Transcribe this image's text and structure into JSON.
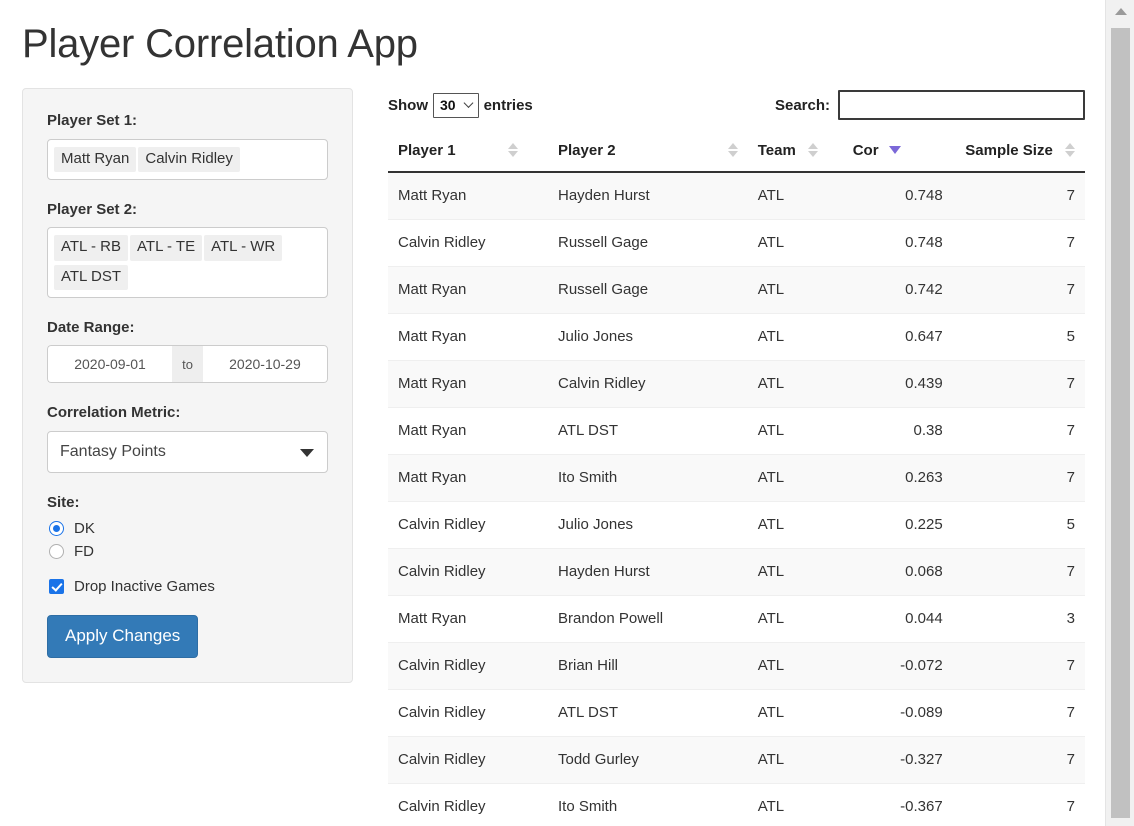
{
  "app": {
    "title": "Player Correlation App"
  },
  "sidebar": {
    "player_set_1": {
      "label": "Player Set 1:",
      "tokens": [
        "Matt Ryan",
        "Calvin Ridley"
      ]
    },
    "player_set_2": {
      "label": "Player Set 2:",
      "tokens": [
        "ATL - RB",
        "ATL - TE",
        "ATL - WR",
        "ATL DST"
      ]
    },
    "date_range": {
      "label": "Date Range:",
      "start": "2020-09-01",
      "separator": "to",
      "end": "2020-10-29"
    },
    "correlation_metric": {
      "label": "Correlation Metric:",
      "selected": "Fantasy Points",
      "caret_icon": "chevron-down-icon"
    },
    "site": {
      "label": "Site:",
      "options": [
        {
          "label": "DK",
          "checked": true
        },
        {
          "label": "FD",
          "checked": false
        }
      ]
    },
    "drop_inactive": {
      "label": "Drop Inactive Games",
      "checked": true
    },
    "apply_button": "Apply Changes"
  },
  "table_controls": {
    "show_label": "Show",
    "entries_value": "30",
    "entries_label": "entries",
    "search_label": "Search:",
    "search_value": "",
    "search_placeholder": ""
  },
  "table": {
    "columns": [
      {
        "label": "Player 1",
        "sort": "none"
      },
      {
        "label": "Player 2",
        "sort": "none"
      },
      {
        "label": "Team",
        "sort": "none"
      },
      {
        "label": "Cor",
        "sort": "desc"
      },
      {
        "label": "Sample Size",
        "sort": "none"
      }
    ],
    "sort_active_color": "#7b68d8",
    "rows": [
      {
        "player1": "Matt Ryan",
        "player2": "Hayden Hurst",
        "team": "ATL",
        "cor": "0.748",
        "sample": "7"
      },
      {
        "player1": "Calvin Ridley",
        "player2": "Russell Gage",
        "team": "ATL",
        "cor": "0.748",
        "sample": "7"
      },
      {
        "player1": "Matt Ryan",
        "player2": "Russell Gage",
        "team": "ATL",
        "cor": "0.742",
        "sample": "7"
      },
      {
        "player1": "Matt Ryan",
        "player2": "Julio Jones",
        "team": "ATL",
        "cor": "0.647",
        "sample": "5"
      },
      {
        "player1": "Matt Ryan",
        "player2": "Calvin Ridley",
        "team": "ATL",
        "cor": "0.439",
        "sample": "7"
      },
      {
        "player1": "Matt Ryan",
        "player2": "ATL DST",
        "team": "ATL",
        "cor": "0.38",
        "sample": "7"
      },
      {
        "player1": "Matt Ryan",
        "player2": "Ito Smith",
        "team": "ATL",
        "cor": "0.263",
        "sample": "7"
      },
      {
        "player1": "Calvin Ridley",
        "player2": "Julio Jones",
        "team": "ATL",
        "cor": "0.225",
        "sample": "5"
      },
      {
        "player1": "Calvin Ridley",
        "player2": "Hayden Hurst",
        "team": "ATL",
        "cor": "0.068",
        "sample": "7"
      },
      {
        "player1": "Matt Ryan",
        "player2": "Brandon Powell",
        "team": "ATL",
        "cor": "0.044",
        "sample": "3"
      },
      {
        "player1": "Calvin Ridley",
        "player2": "Brian Hill",
        "team": "ATL",
        "cor": "-0.072",
        "sample": "7"
      },
      {
        "player1": "Calvin Ridley",
        "player2": "ATL DST",
        "team": "ATL",
        "cor": "-0.089",
        "sample": "7"
      },
      {
        "player1": "Calvin Ridley",
        "player2": "Todd Gurley",
        "team": "ATL",
        "cor": "-0.327",
        "sample": "7"
      },
      {
        "player1": "Calvin Ridley",
        "player2": "Ito Smith",
        "team": "ATL",
        "cor": "-0.367",
        "sample": "7"
      }
    ]
  },
  "scrollbar": {
    "up_arrow_icon": "triangle-up-icon"
  }
}
